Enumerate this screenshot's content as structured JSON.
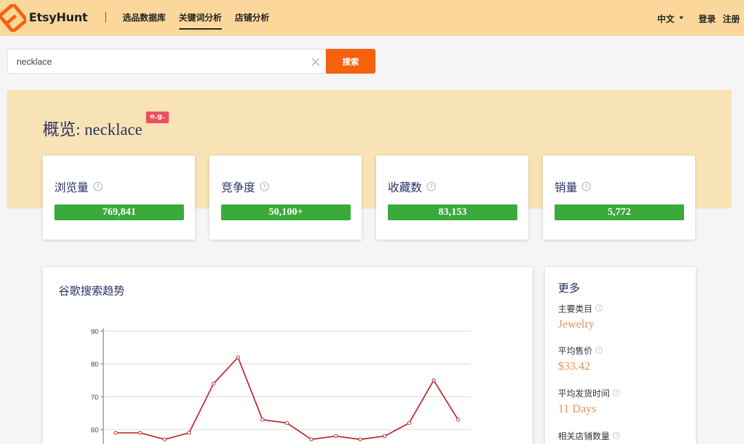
{
  "header": {
    "brand": "EtsyHunt",
    "nav": [
      {
        "label": "选品数据库",
        "active": false
      },
      {
        "label": "关键词分析",
        "active": true
      },
      {
        "label": "店铺分析",
        "active": false
      }
    ],
    "language": "中文",
    "login": "登录",
    "register": "注册"
  },
  "search": {
    "value": "necklace",
    "button_label": "搜索"
  },
  "overview": {
    "title": "概览: necklace",
    "badge": "e.g."
  },
  "stats": [
    {
      "label": "浏览量",
      "value": "769,841"
    },
    {
      "label": "竞争度",
      "value": "50,100+"
    },
    {
      "label": "收藏数",
      "value": "83,153"
    },
    {
      "label": "销量",
      "value": "5,772"
    }
  ],
  "trend": {
    "title": "谷歌搜索趋势"
  },
  "more": {
    "title": "更多",
    "items": [
      {
        "label": "主要类目",
        "value": "Jewelry"
      },
      {
        "label": "平均售价",
        "value": "$33.42"
      },
      {
        "label": "平均发货时间",
        "value": "11 Days"
      },
      {
        "label": "相关店铺数量",
        "value": ""
      }
    ]
  },
  "colors": {
    "header_bg": "#fbd79b",
    "accent_orange": "#f5620f",
    "overview_bg": "#f7e3b5",
    "stat_green": "#3aaa3a",
    "badge_red": "#ef4f5c",
    "title_navy": "#2a3566",
    "value_orange": "#e89356",
    "line_red": "#c0282d"
  },
  "chart_data": {
    "type": "line",
    "title": "谷歌搜索趋势",
    "xlabel": "",
    "ylabel": "",
    "yticks": [
      60,
      70,
      80,
      90
    ],
    "ylim": [
      55,
      90
    ],
    "grid": true,
    "series": [
      {
        "values": [
          59,
          59,
          57,
          59,
          74,
          82,
          63,
          62,
          57,
          58,
          57,
          58,
          62,
          75,
          63
        ]
      }
    ]
  }
}
